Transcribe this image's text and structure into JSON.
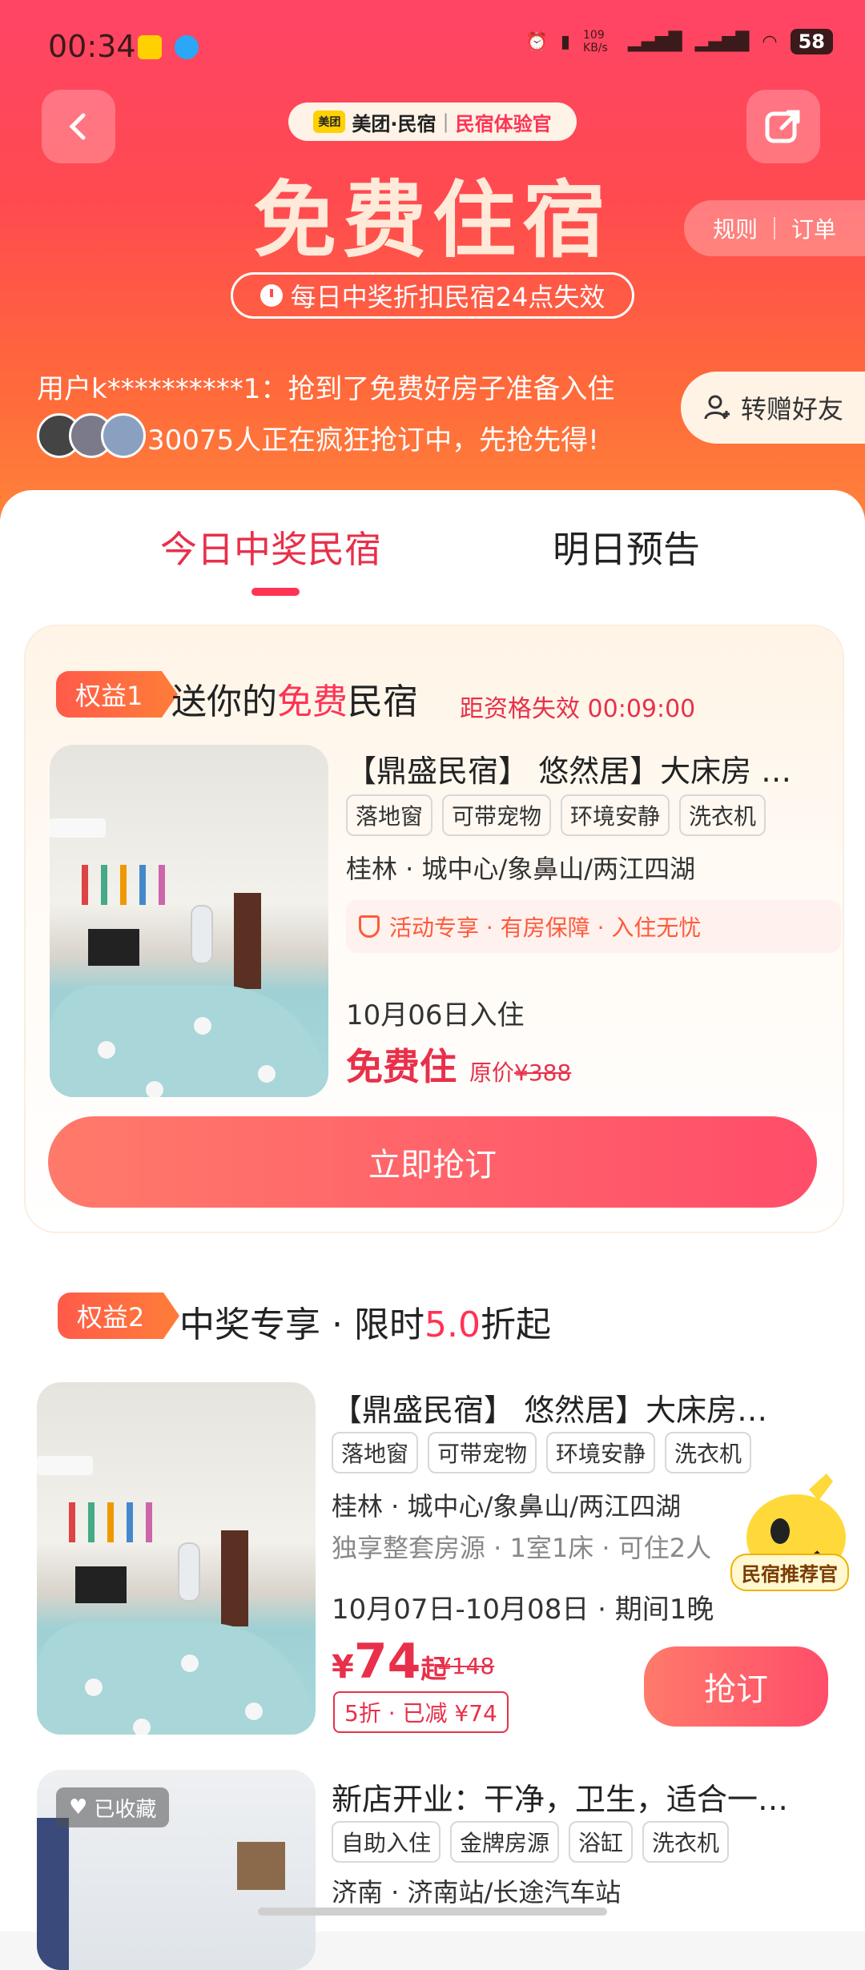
{
  "status_bar": {
    "time": "00:34",
    "net_speed": "109 KB/s",
    "battery": "58"
  },
  "header": {
    "brand_logo": "美团",
    "brand_name": "美团·民宿",
    "brand_separator": "|",
    "brand_sub": "民宿体验官",
    "title": "免费住宿",
    "badge": "每日中奖折扣民宿24点失效",
    "rules": "规则",
    "orders": "订单"
  },
  "ticker": {
    "line1": "用户k**********1：抢到了免费好房子准备入住",
    "line2": "30075人正在疯狂抢订中，先抢先得!",
    "gift_button": "转赠好友"
  },
  "tabs": [
    {
      "label": "今日中奖民宿"
    },
    {
      "label": "明日预告"
    }
  ],
  "perk1": {
    "tag": "权益1",
    "title_prefix": "送你的",
    "title_highlight": "免费",
    "title_suffix": "民宿",
    "countdown": "距资格失效 00:09:00",
    "listing": {
      "title": "【鼎盛民宿】 悠然居】大床房 …",
      "tags": [
        "落地窗",
        "可带宠物",
        "环境安静",
        "洗衣机"
      ],
      "location": "桂林 · 城中心/象鼻山/两江四湖",
      "guarantee": "活动专享 · 有房保障 · 入住无忧",
      "checkin": "10月06日入住",
      "price_label": "免费住",
      "orig_label": "原价",
      "orig_price": "¥388"
    },
    "button": "立即抢订"
  },
  "perk2": {
    "tag": "权益2",
    "title_prefix": "中奖专享 · 限时",
    "title_highlight": "5.0",
    "title_suffix": "折起",
    "listing": {
      "title": "【鼎盛民宿】 悠然居】大床房…",
      "tags": [
        "落地窗",
        "可带宠物",
        "环境安静",
        "洗衣机"
      ],
      "location": "桂林 · 城中心/象鼻山/两江四湖",
      "detail": "独享整套房源 · 1室1床 · 可住2人",
      "dates": "10月07日-10月08日 · 期间1晚",
      "price_currency": "¥",
      "price": "74",
      "price_suffix": "起",
      "orig_price": "¥148",
      "discount": "5折 · 已减 ¥74",
      "button": "抢订"
    },
    "mascot_label": "民宿推荐官"
  },
  "listing3": {
    "fav": "已收藏",
    "title": "新店开业：干净，卫生，适合一…",
    "tags": [
      "自助入住",
      "金牌房源",
      "浴缸",
      "洗衣机"
    ],
    "location": "济南 · 济南站/长途汽车站"
  },
  "colors": {
    "accent": "#ff3355",
    "hero_top": "#ff4466",
    "hero_bottom": "#ff8a3a"
  }
}
